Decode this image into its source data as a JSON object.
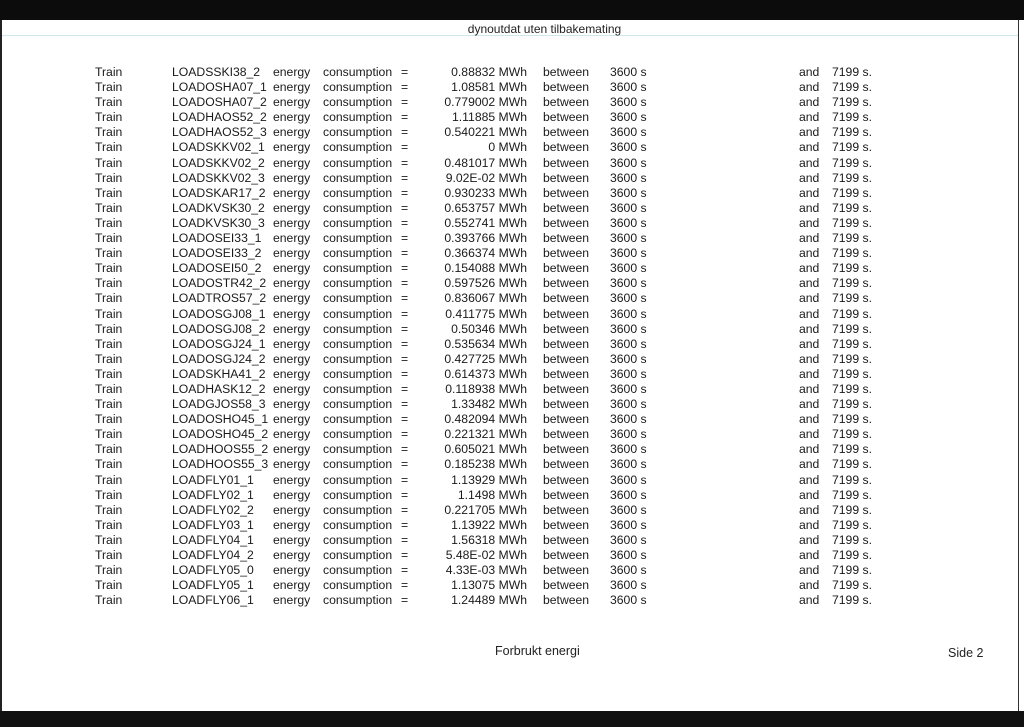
{
  "header": {
    "title": "dynoutdat uten tilbakemating"
  },
  "footer": {
    "title": "Forbrukt energi",
    "page": "Side 2"
  },
  "labels": {
    "energy": "energy",
    "consumption": "consumption",
    "equals": "=",
    "between": "between",
    "and": "and"
  },
  "rows": [
    {
      "type": "Train",
      "load": "LOADSSKI38_2",
      "value": "0.88832 MWh",
      "start": "3600 s",
      "end": "7199 s."
    },
    {
      "type": "Train",
      "load": "LOADOSHA07_1",
      "value": "1.08581 MWh",
      "start": "3600 s",
      "end": "7199 s."
    },
    {
      "type": "Train",
      "load": "LOADOSHA07_2",
      "value": "0.779002 MWh",
      "start": "3600 s",
      "end": "7199 s."
    },
    {
      "type": "Train",
      "load": "LOADHAOS52_2",
      "value": "1.11885 MWh",
      "start": "3600 s",
      "end": "7199 s."
    },
    {
      "type": "Train",
      "load": "LOADHAOS52_3",
      "value": "0.540221 MWh",
      "start": "3600 s",
      "end": "7199 s."
    },
    {
      "type": "Train",
      "load": "LOADSKKV02_1",
      "value": "0 MWh",
      "start": "3600 s",
      "end": "7199 s."
    },
    {
      "type": "Train",
      "load": "LOADSKKV02_2",
      "value": "0.481017 MWh",
      "start": "3600 s",
      "end": "7199 s."
    },
    {
      "type": "Train",
      "load": "LOADSKKV02_3",
      "value": "9.02E-02 MWh",
      "start": "3600 s",
      "end": "7199 s."
    },
    {
      "type": "Train",
      "load": "LOADSKAR17_2",
      "value": "0.930233 MWh",
      "start": "3600 s",
      "end": "7199 s."
    },
    {
      "type": "Train",
      "load": "LOADKVSK30_2",
      "value": "0.653757 MWh",
      "start": "3600 s",
      "end": "7199 s."
    },
    {
      "type": "Train",
      "load": "LOADKVSK30_3",
      "value": "0.552741 MWh",
      "start": "3600 s",
      "end": "7199 s."
    },
    {
      "type": "Train",
      "load": "LOADOSEI33_1",
      "value": "0.393766 MWh",
      "start": "3600 s",
      "end": "7199 s."
    },
    {
      "type": "Train",
      "load": "LOADOSEI33_2",
      "value": "0.366374 MWh",
      "start": "3600 s",
      "end": "7199 s."
    },
    {
      "type": "Train",
      "load": "LOADOSEI50_2",
      "value": "0.154088 MWh",
      "start": "3600 s",
      "end": "7199 s."
    },
    {
      "type": "Train",
      "load": "LOADOSTR42_2",
      "value": "0.597526 MWh",
      "start": "3600 s",
      "end": "7199 s."
    },
    {
      "type": "Train",
      "load": "LOADTROS57_2",
      "value": "0.836067 MWh",
      "start": "3600 s",
      "end": "7199 s."
    },
    {
      "type": "Train",
      "load": "LOADOSGJ08_1",
      "value": "0.411775 MWh",
      "start": "3600 s",
      "end": "7199 s."
    },
    {
      "type": "Train",
      "load": "LOADOSGJ08_2",
      "value": "0.50346 MWh",
      "start": "3600 s",
      "end": "7199 s."
    },
    {
      "type": "Train",
      "load": "LOADOSGJ24_1",
      "value": "0.535634 MWh",
      "start": "3600 s",
      "end": "7199 s."
    },
    {
      "type": "Train",
      "load": "LOADOSGJ24_2",
      "value": "0.427725 MWh",
      "start": "3600 s",
      "end": "7199 s."
    },
    {
      "type": "Train",
      "load": "LOADSKHA41_2",
      "value": "0.614373 MWh",
      "start": "3600 s",
      "end": "7199 s."
    },
    {
      "type": "Train",
      "load": "LOADHASK12_2",
      "value": "0.118938 MWh",
      "start": "3600 s",
      "end": "7199 s."
    },
    {
      "type": "Train",
      "load": "LOADGJOS58_3",
      "value": "1.33482 MWh",
      "start": "3600 s",
      "end": "7199 s."
    },
    {
      "type": "Train",
      "load": "LOADOSHO45_1",
      "value": "0.482094 MWh",
      "start": "3600 s",
      "end": "7199 s."
    },
    {
      "type": "Train",
      "load": "LOADOSHO45_2",
      "value": "0.221321 MWh",
      "start": "3600 s",
      "end": "7199 s."
    },
    {
      "type": "Train",
      "load": "LOADHOOS55_2",
      "value": "0.605021 MWh",
      "start": "3600 s",
      "end": "7199 s."
    },
    {
      "type": "Train",
      "load": "LOADHOOS55_3",
      "value": "0.185238 MWh",
      "start": "3600 s",
      "end": "7199 s."
    },
    {
      "type": "Train",
      "load": "LOADFLY01_1",
      "value": "1.13929 MWh",
      "start": "3600 s",
      "end": "7199 s."
    },
    {
      "type": "Train",
      "load": "LOADFLY02_1",
      "value": "1.1498 MWh",
      "start": "3600 s",
      "end": "7199 s."
    },
    {
      "type": "Train",
      "load": "LOADFLY02_2",
      "value": "0.221705 MWh",
      "start": "3600 s",
      "end": "7199 s."
    },
    {
      "type": "Train",
      "load": "LOADFLY03_1",
      "value": "1.13922 MWh",
      "start": "3600 s",
      "end": "7199 s."
    },
    {
      "type": "Train",
      "load": "LOADFLY04_1",
      "value": "1.56318 MWh",
      "start": "3600 s",
      "end": "7199 s."
    },
    {
      "type": "Train",
      "load": "LOADFLY04_2",
      "value": "5.48E-02 MWh",
      "start": "3600 s",
      "end": "7199 s."
    },
    {
      "type": "Train",
      "load": "LOADFLY05_0",
      "value": "4.33E-03 MWh",
      "start": "3600 s",
      "end": "7199 s."
    },
    {
      "type": "Train",
      "load": "LOADFLY05_1",
      "value": "1.13075 MWh",
      "start": "3600 s",
      "end": "7199 s."
    },
    {
      "type": "Train",
      "load": "LOADFLY06_1",
      "value": "1.24489 MWh",
      "start": "3600 s",
      "end": "7199 s."
    }
  ]
}
